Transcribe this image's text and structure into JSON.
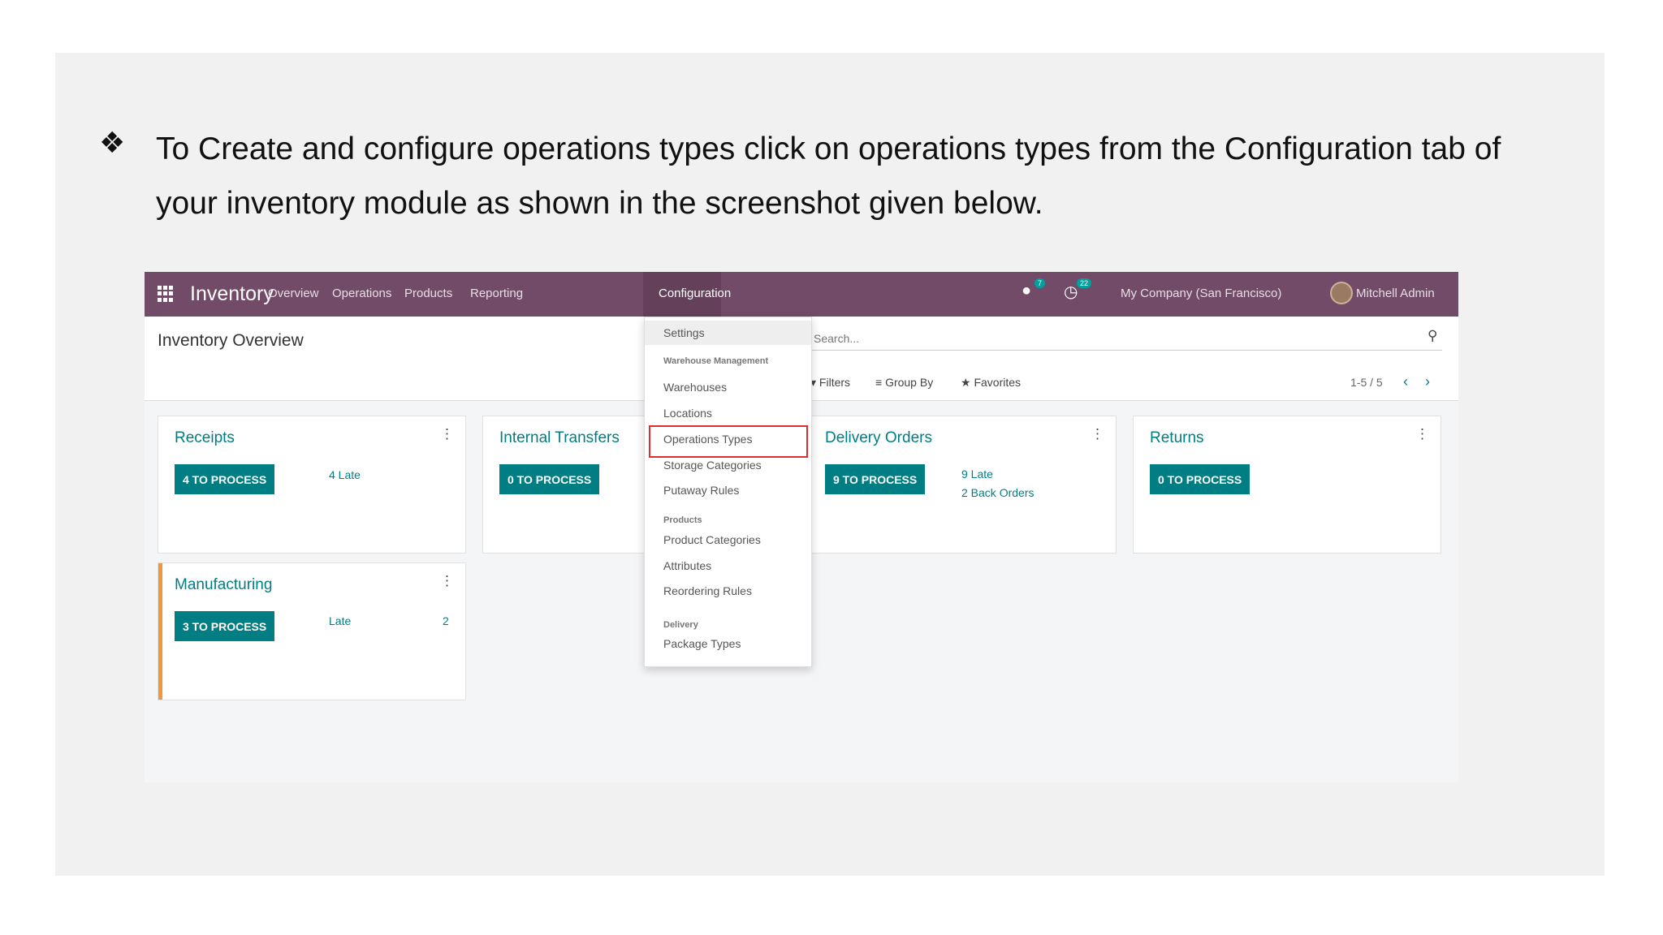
{
  "instruction": {
    "bullet": "❖",
    "text": "To Create and configure operations types click on operations types from the Configuration tab of your inventory module as shown in the screenshot given below."
  },
  "topbar": {
    "app_name": "Inventory",
    "menu": [
      "Overview",
      "Operations",
      "Products",
      "Reporting",
      "Configuration"
    ],
    "chat_badge": "7",
    "activity_badge": "22",
    "company": "My Company (San Francisco)",
    "user": "Mitchell Admin",
    "bar_color": "#714b67"
  },
  "control": {
    "title": "Inventory Overview",
    "search_placeholder": "Search...",
    "filters": "Filters",
    "group_by": "Group By",
    "favorites": "Favorites",
    "pager": "1-5 / 5"
  },
  "cards": [
    {
      "title": "Receipts",
      "button": "4 TO PROCESS",
      "notes": [
        "4 Late"
      ]
    },
    {
      "title": "Internal Transfers",
      "button": "0 TO PROCESS",
      "notes": []
    },
    {
      "title": "Delivery Orders",
      "button": "9 TO PROCESS",
      "notes": [
        "9 Late",
        "2 Back Orders"
      ]
    },
    {
      "title": "Returns",
      "button": "0 TO PROCESS",
      "notes": []
    },
    {
      "title": "Manufacturing",
      "button": "3 TO PROCESS",
      "notes": [
        "Late",
        "2"
      ]
    }
  ],
  "dropdown": {
    "settings": "Settings",
    "warehouse_header": "Warehouse Management",
    "warehouses": "Warehouses",
    "locations": "Locations",
    "operations_types": "Operations Types",
    "storage_categories": "Storage Categories",
    "putaway_rules": "Putaway Rules",
    "products_header": "Products",
    "product_categories": "Product Categories",
    "attributes": "Attributes",
    "reordering_rules": "Reordering Rules",
    "delivery_header": "Delivery",
    "package_types": "Package Types"
  },
  "colors": {
    "accent": "#017e84",
    "highlight": "#d9302f",
    "late_bar": "#f0963c"
  }
}
